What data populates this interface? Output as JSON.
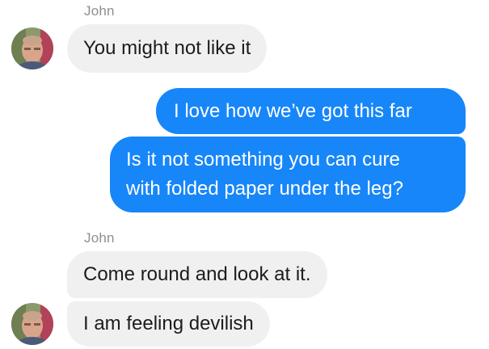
{
  "conversation": {
    "groups": [
      {
        "sender": "John",
        "direction": "incoming",
        "messages": [
          "You might not like it"
        ]
      },
      {
        "direction": "outgoing",
        "messages": [
          "I love how we’ve got this far",
          "Is it not something you can cure",
          "with folded paper under the leg?"
        ]
      },
      {
        "sender": "John",
        "direction": "incoming",
        "messages": [
          "Come round and look at it.",
          "I am feeling devilish"
        ]
      }
    ]
  },
  "colors": {
    "incoming_bubble": "#f0f0f0",
    "outgoing_bubble": "#1786f9",
    "sender_name": "#8e8e93"
  },
  "icons": {
    "avatar": "profile-photo-avatar"
  }
}
